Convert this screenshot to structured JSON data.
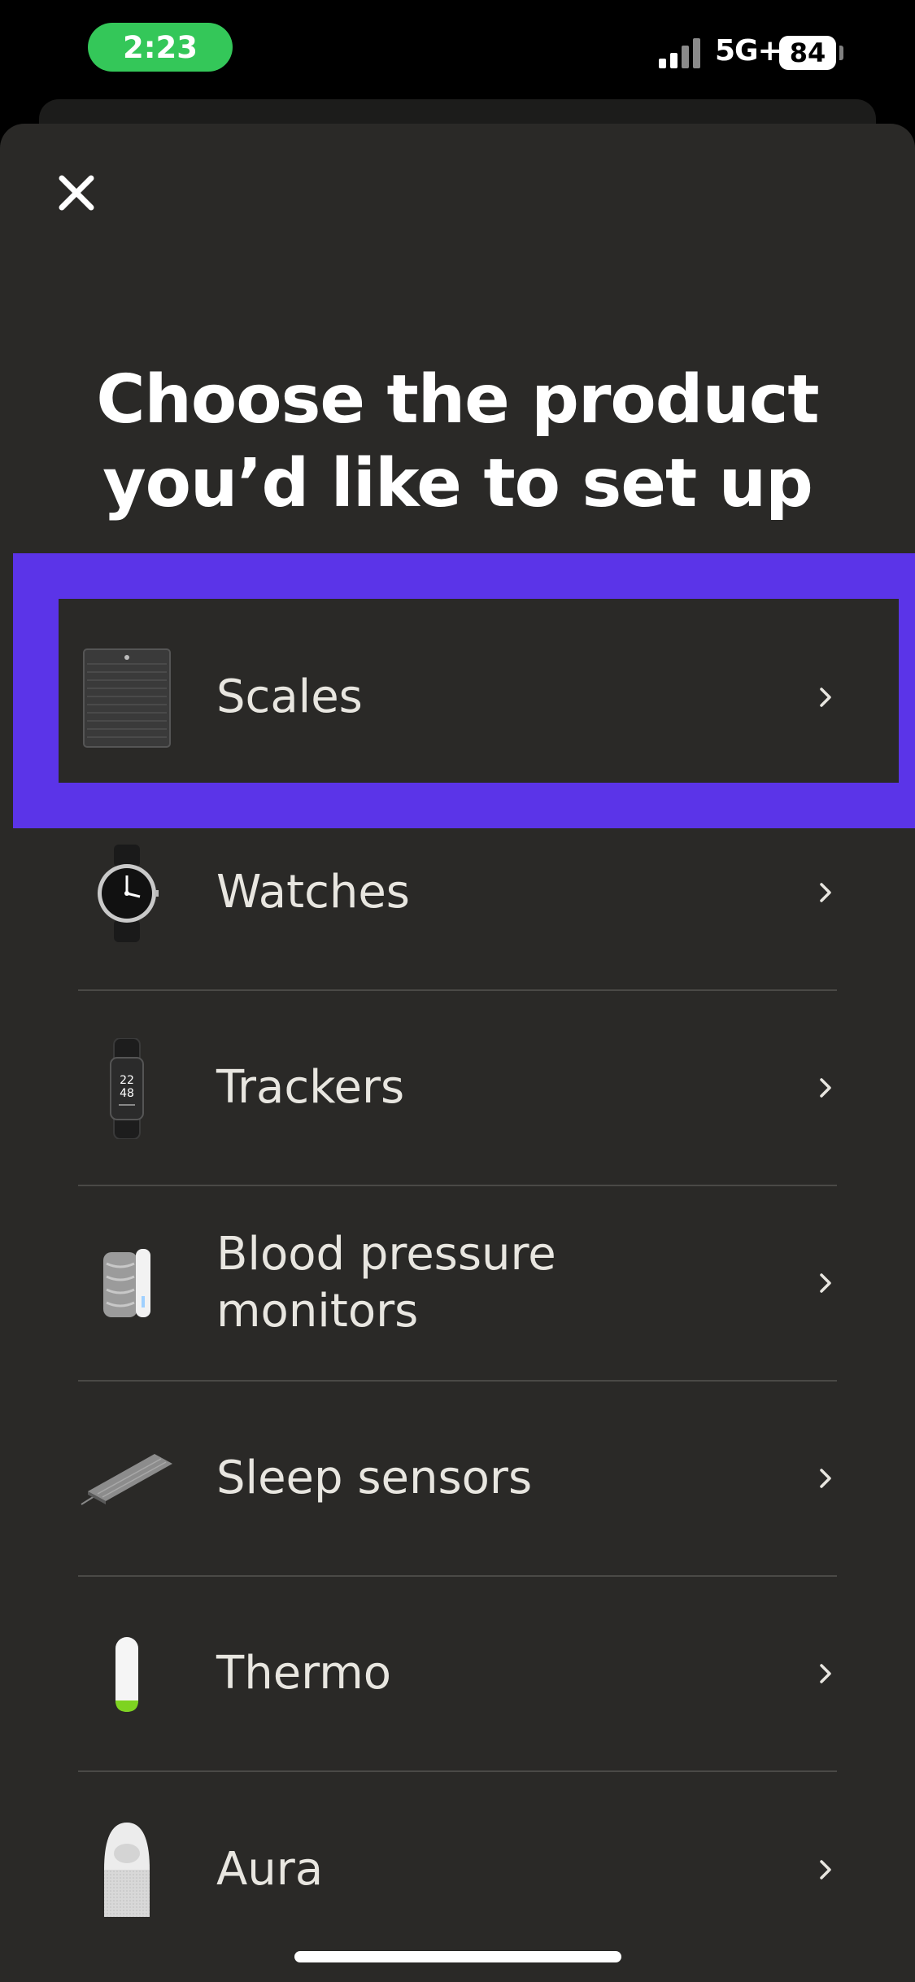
{
  "status_bar": {
    "time": "2:23",
    "network": "5G+",
    "battery": "84",
    "icons": [
      "signal-icon",
      "battery-icon"
    ]
  },
  "header": {
    "close_icon": "close-icon",
    "title": "Choose the product you’d like to set up"
  },
  "products": [
    {
      "label": "Scales",
      "icon": "scale-icon",
      "highlighted": true
    },
    {
      "label": "Watches",
      "icon": "watch-icon"
    },
    {
      "label": "Trackers",
      "icon": "tracker-icon"
    },
    {
      "label": "Blood pressure monitors",
      "icon": "blood-pressure-monitor-icon"
    },
    {
      "label": "Sleep sensors",
      "icon": "sleep-sensor-icon"
    },
    {
      "label": "Thermo",
      "icon": "thermometer-icon"
    },
    {
      "label": "Aura",
      "icon": "aura-icon"
    }
  ],
  "colors": {
    "background": "#2a2927",
    "highlight": "#5b34e8",
    "status_time_pill": "#34c759",
    "text": "#e8e6e0",
    "divider": "#4a4946"
  }
}
